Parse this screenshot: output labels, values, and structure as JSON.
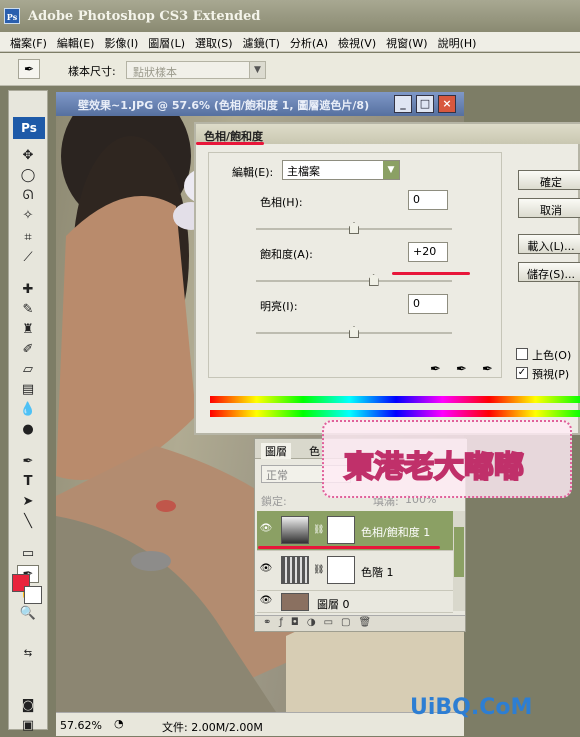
{
  "app": {
    "title": "Adobe Photoshop CS3 Extended"
  },
  "menu": [
    "檔案(F)",
    "編輯(E)",
    "影像(I)",
    "圖層(L)",
    "選取(S)",
    "濾鏡(T)",
    "分析(A)",
    "檢視(V)",
    "視窗(W)",
    "說明(H)"
  ],
  "options": {
    "sample_label": "樣本尺寸:",
    "sample_value": "點狀樣本"
  },
  "document": {
    "title": "壁效果~1.JPG @ 57.6% (色相/飽和度 1, 圖層遮色片/8)",
    "zoom": "57.62%",
    "doc_size": "文件: 2.00M/2.00M"
  },
  "dialog": {
    "title": "色相/飽和度",
    "edit_label": "編輯(E):",
    "edit_value": "主檔案",
    "hue_label": "色相(H):",
    "hue_value": "0",
    "hue_pos": 0.5,
    "sat_label": "飽和度(A):",
    "sat_value": "+20",
    "sat_pos": 0.6,
    "light_label": "明亮(I):",
    "light_value": "0",
    "light_pos": 0.5,
    "ok": "確定",
    "cancel": "取消",
    "load": "載入(L)...",
    "save": "儲存(S)...",
    "colorize_label": "上色(O)",
    "preview_label": "預視(P)",
    "colorize_checked": false,
    "preview_checked": true
  },
  "layers": {
    "tabs": [
      "圖層",
      "色"
    ],
    "blend_mode": "正常",
    "lock_label": "鎖定:",
    "fill_label": "填滿:",
    "fill_value": "100%",
    "items": [
      {
        "name": "色相/飽和度 1",
        "selected": true
      },
      {
        "name": "色階 1",
        "selected": false
      },
      {
        "name": "圖層 0",
        "selected": false
      }
    ]
  },
  "watermarks": {
    "blog": "東港老大嘟嘟",
    "site": "UiBQ.CoM"
  },
  "colors": {
    "highlight": "#e8163a",
    "selected_layer": "#8ba064",
    "foreground": "#e8243c"
  }
}
